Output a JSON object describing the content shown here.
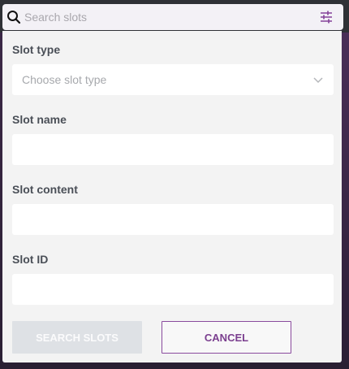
{
  "search": {
    "placeholder": "Search slots"
  },
  "form": {
    "slot_type": {
      "label": "Slot type",
      "placeholder": "Choose slot type"
    },
    "slot_name": {
      "label": "Slot name",
      "value": ""
    },
    "slot_content": {
      "label": "Slot content",
      "value": ""
    },
    "slot_id": {
      "label": "Slot ID",
      "value": ""
    }
  },
  "actions": {
    "search_label": "SEARCH SLOTS",
    "cancel_label": "CANCEL"
  },
  "colors": {
    "accent": "#8a4b9e",
    "panel_bg": "#f3f3f3",
    "disabled_button": "#dee1e5"
  },
  "icons": {
    "search": "search-icon",
    "filter": "sliders-icon",
    "chevron": "chevron-down-icon"
  }
}
